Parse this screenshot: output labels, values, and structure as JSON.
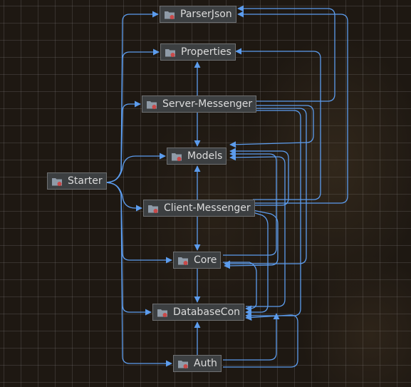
{
  "diagram": {
    "modules": [
      {
        "id": "parserjson",
        "label": "ParserJson"
      },
      {
        "id": "properties",
        "label": "Properties"
      },
      {
        "id": "server-messenger",
        "label": "Server-Messenger"
      },
      {
        "id": "models",
        "label": "Models"
      },
      {
        "id": "starter",
        "label": "Starter"
      },
      {
        "id": "client-messenger",
        "label": "Client-Messenger"
      },
      {
        "id": "core",
        "label": "Core"
      },
      {
        "id": "databasecon",
        "label": "DatabaseCon"
      },
      {
        "id": "auth",
        "label": "Auth"
      }
    ],
    "dependencies": [
      {
        "from": "Starter",
        "to": "ParserJson"
      },
      {
        "from": "Starter",
        "to": "Properties"
      },
      {
        "from": "Starter",
        "to": "Server-Messenger"
      },
      {
        "from": "Starter",
        "to": "Models"
      },
      {
        "from": "Starter",
        "to": "Client-Messenger"
      },
      {
        "from": "Starter",
        "to": "Core"
      },
      {
        "from": "Starter",
        "to": "DatabaseCon"
      },
      {
        "from": "Starter",
        "to": "Auth"
      },
      {
        "from": "Server-Messenger",
        "to": "Properties"
      },
      {
        "from": "Server-Messenger",
        "to": "Models"
      },
      {
        "from": "Server-Messenger",
        "to": "ParserJson"
      },
      {
        "from": "Server-Messenger",
        "to": "Core"
      },
      {
        "from": "Server-Messenger",
        "to": "DatabaseCon"
      },
      {
        "from": "Client-Messenger",
        "to": "Models"
      },
      {
        "from": "Client-Messenger",
        "to": "ParserJson"
      },
      {
        "from": "Client-Messenger",
        "to": "Properties"
      },
      {
        "from": "Client-Messenger",
        "to": "Core"
      },
      {
        "from": "Client-Messenger",
        "to": "DatabaseCon"
      },
      {
        "from": "Core",
        "to": "Models"
      },
      {
        "from": "Core",
        "to": "DatabaseCon"
      },
      {
        "from": "DatabaseCon",
        "to": "Models"
      },
      {
        "from": "Auth",
        "to": "DatabaseCon"
      },
      {
        "from": "Auth",
        "to": "Models"
      }
    ]
  },
  "colors": {
    "edge": "#5c9ced",
    "node_fill": "#3c3f41",
    "node_border": "#6e7072",
    "node_text": "#dcdcdc",
    "folder_icon": "#8f9ba8",
    "module_badge": "#c94a4a"
  },
  "icons": {
    "module": "module-folder-icon"
  }
}
